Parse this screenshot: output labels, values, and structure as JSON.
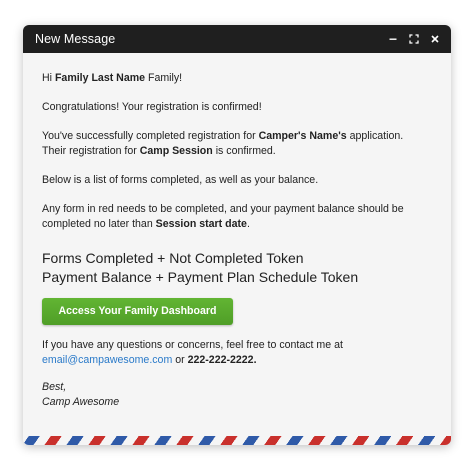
{
  "window": {
    "title": "New Message",
    "controls": [
      "minimize-icon",
      "expand-icon",
      "close-icon"
    ]
  },
  "email": {
    "greeting_prefix": "Hi ",
    "greeting_name": "Family Last Name",
    "greeting_suffix": " Family!",
    "congrats": "Congratulations! Your registration is confirmed!",
    "p1_part1": "You've successfully completed registration for ",
    "p1_name": "Camper's Name's",
    "p1_part2": " application.",
    "p1_part3": "Their registration for ",
    "p1_session": "Camp Session",
    "p1_part4": " is confirmed.",
    "forms_intro": "Below is a list of forms completed, as well as your balance.",
    "red_note_part1": "Any form in red needs to be completed, and your payment balance should be completed no later than ",
    "red_note_date": "Session start date",
    "red_note_part2": ".",
    "token_line1": "Forms Completed + Not Completed Token",
    "token_line2": "Payment Balance + Payment Plan Schedule Token",
    "cta_label": "Access Your Family Dashboard",
    "contact_part1": "If you have any questions or concerns, feel free to contact me at",
    "contact_email": "email@campawesome.com",
    "contact_or": " or ",
    "contact_phone": "222-222-2222.",
    "sign_off": "Best,",
    "signature": "Camp Awesome"
  },
  "colors": {
    "titlebar": "#1f1f1f",
    "button": "#5aaa2e",
    "link": "#2a7ac9",
    "stripe_red": "#c9302c",
    "stripe_blue": "#2f5aa8"
  }
}
